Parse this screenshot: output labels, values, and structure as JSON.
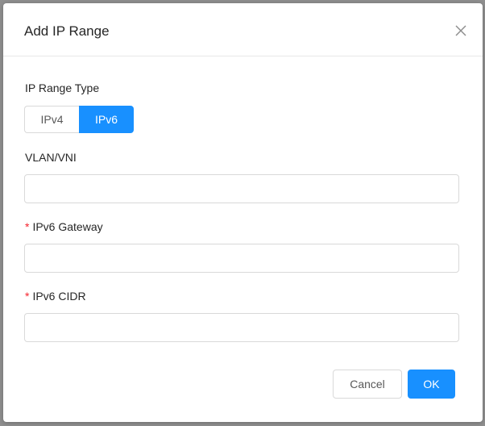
{
  "dialog": {
    "title": "Add IP Range",
    "close_icon": "close-icon"
  },
  "form": {
    "ip_range_type": {
      "label": "IP Range Type",
      "options": [
        "IPv4",
        "IPv6"
      ],
      "selected": "IPv6"
    },
    "vlan_vni": {
      "label": "VLAN/VNI",
      "value": "",
      "required": false
    },
    "ipv6_gateway": {
      "label": "IPv6 Gateway",
      "value": "",
      "required": true
    },
    "ipv6_cidr": {
      "label": "IPv6 CIDR",
      "value": "",
      "required": true
    },
    "required_marker": "*"
  },
  "footer": {
    "cancel_label": "Cancel",
    "ok_label": "OK"
  },
  "colors": {
    "primary": "#1890ff",
    "required": "#f5222d",
    "border": "#d9d9d9"
  }
}
